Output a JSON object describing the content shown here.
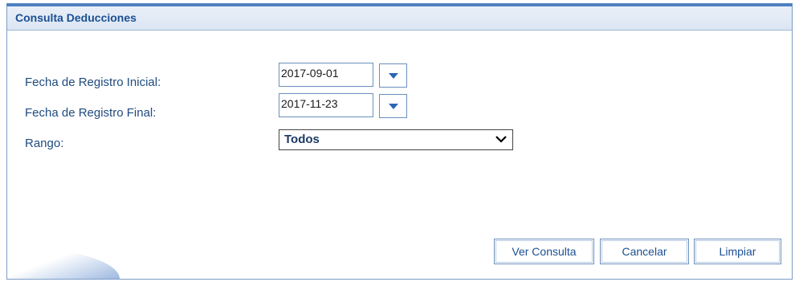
{
  "panel": {
    "title": "Consulta Deducciones"
  },
  "form": {
    "fecha_inicial_label": "Fecha de Registro Inicial:",
    "fecha_inicial_value": "2017-09-01",
    "fecha_final_label": "Fecha de Registro Final:",
    "fecha_final_value": "2017-11-23",
    "rango_label": "Rango:",
    "rango_selected": "Todos"
  },
  "buttons": {
    "ver_consulta": "Ver Consulta",
    "cancelar": "Cancelar",
    "limpiar": "Limpiar"
  },
  "icons": {
    "date_dropdown": "triangle-down-icon",
    "select_chevron": "chevron-down-icon"
  },
  "colors": {
    "accent": "#4f7fc0",
    "label_text": "#1f4a7f",
    "button_text": "#1b4f93"
  }
}
